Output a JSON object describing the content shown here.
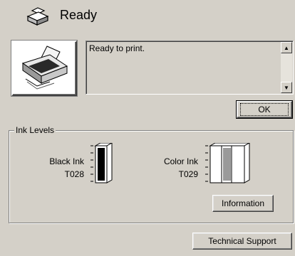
{
  "header": {
    "title": "Ready"
  },
  "status": {
    "message": "Ready to print."
  },
  "buttons": {
    "ok": "OK",
    "information": "Information",
    "technical_support": "Technical Support"
  },
  "ink_levels": {
    "group_label": "Ink Levels",
    "black": {
      "name": "Black Ink",
      "code": "T028",
      "level": 1.0
    },
    "color": {
      "name": "Color Ink",
      "code": "T029",
      "level": 1.0
    }
  }
}
